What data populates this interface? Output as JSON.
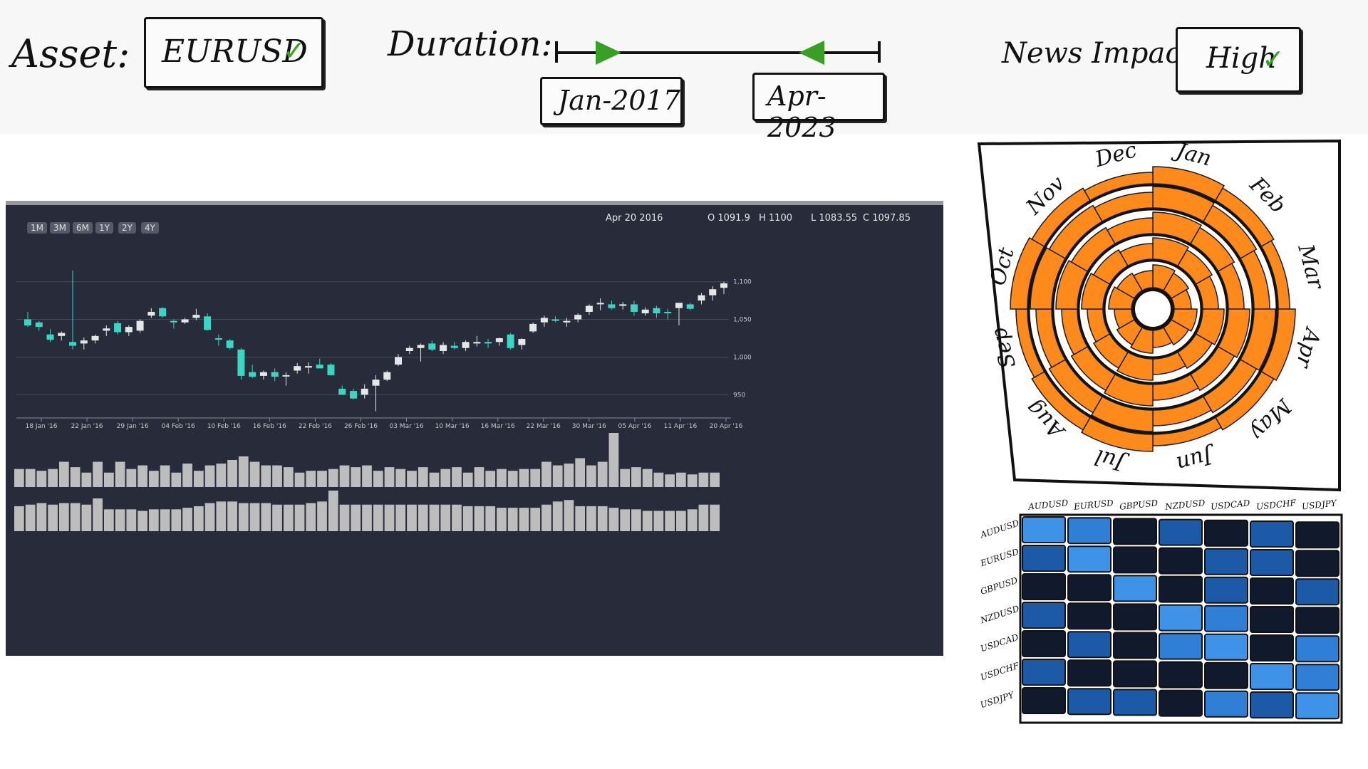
{
  "controls": {
    "asset_label": "Asset:",
    "asset_value": "EURUSD",
    "duration_label": "Duration:",
    "duration_start": "Jan-2017",
    "duration_end": "Apr-2023",
    "news_label": "News Impact",
    "news_value": "High"
  },
  "chart": {
    "range_buttons": [
      "1M",
      "3M",
      "6M",
      "1Y",
      "2Y",
      "4Y"
    ],
    "date": "Apr 20 2016",
    "open": "O 1091.9",
    "high": "H 1100",
    "low": "L 1083.55",
    "close": "C 1097.85",
    "colors": {
      "background": "#272b3a",
      "up": "#e6e6e6",
      "down": "#3ad6c2",
      "volume": "#bdbdbd"
    }
  },
  "chart_data": {
    "type": "candlestick",
    "x_ticks": [
      "18 Jan '16",
      "22 Jan '16",
      "29 Jan '16",
      "04 Feb '16",
      "10 Feb '16",
      "16 Feb '16",
      "22 Feb '16",
      "26 Feb '16",
      "03 Mar '16",
      "10 Mar '16",
      "16 Mar '16",
      "22 Mar '16",
      "30 Mar '16",
      "05 Apr '16",
      "11 Apr '16",
      "20 Apr '16"
    ],
    "y_ticks": [
      "1,100",
      "1,050",
      "1,000",
      "950"
    ],
    "ylim": [
      922,
      1128
    ],
    "candles": [
      [
        1050,
        1060,
        1040,
        1042
      ],
      [
        1046,
        1048,
        1035,
        1040
      ],
      [
        1030,
        1037,
        1020,
        1023
      ],
      [
        1028,
        1034,
        1022,
        1032
      ],
      [
        1020,
        1115,
        1010,
        1015
      ],
      [
        1018,
        1026,
        1010,
        1022
      ],
      [
        1022,
        1030,
        1018,
        1028
      ],
      [
        1035,
        1042,
        1028,
        1038
      ],
      [
        1045,
        1048,
        1030,
        1033
      ],
      [
        1033,
        1042,
        1028,
        1040
      ],
      [
        1035,
        1050,
        1032,
        1048
      ],
      [
        1055,
        1065,
        1052,
        1060
      ],
      [
        1065,
        1066,
        1052,
        1054
      ],
      [
        1048,
        1050,
        1038,
        1046
      ],
      [
        1046,
        1052,
        1044,
        1050
      ],
      [
        1052,
        1064,
        1049,
        1056
      ],
      [
        1054,
        1058,
        1035,
        1036
      ],
      [
        1025,
        1030,
        1015,
        1024
      ],
      [
        1022,
        1024,
        1010,
        1012
      ],
      [
        1010,
        1012,
        970,
        975
      ],
      [
        980,
        990,
        972,
        974
      ],
      [
        975,
        982,
        970,
        980
      ],
      [
        980,
        985,
        968,
        974
      ],
      [
        975,
        980,
        962,
        976
      ],
      [
        982,
        992,
        978,
        988
      ],
      [
        986,
        993,
        978,
        988
      ],
      [
        990,
        998,
        988,
        985
      ],
      [
        990,
        992,
        976,
        976
      ],
      [
        958,
        962,
        950,
        950
      ],
      [
        955,
        958,
        944,
        945
      ],
      [
        950,
        964,
        945,
        958
      ],
      [
        962,
        976,
        928,
        970
      ],
      [
        970,
        982,
        968,
        980
      ],
      [
        990,
        1004,
        988,
        1000
      ],
      [
        1008,
        1015,
        1004,
        1012
      ],
      [
        1012,
        1018,
        994,
        1016
      ],
      [
        1018,
        1022,
        1008,
        1010
      ],
      [
        1008,
        1020,
        1004,
        1016
      ],
      [
        1015,
        1020,
        1010,
        1012
      ],
      [
        1012,
        1022,
        1008,
        1020
      ],
      [
        1018,
        1028,
        1014,
        1020
      ],
      [
        1020,
        1024,
        1012,
        1018
      ],
      [
        1020,
        1026,
        1015,
        1025
      ],
      [
        1030,
        1032,
        1010,
        1012
      ],
      [
        1016,
        1025,
        1010,
        1024
      ],
      [
        1034,
        1046,
        1032,
        1044
      ],
      [
        1046,
        1055,
        1040,
        1052
      ],
      [
        1050,
        1054,
        1046,
        1048
      ],
      [
        1046,
        1052,
        1040,
        1048
      ],
      [
        1050,
        1058,
        1046,
        1056
      ],
      [
        1060,
        1070,
        1056,
        1068
      ],
      [
        1070,
        1078,
        1062,
        1072
      ],
      [
        1070,
        1075,
        1063,
        1065
      ],
      [
        1068,
        1073,
        1063,
        1070
      ],
      [
        1070,
        1075,
        1055,
        1060
      ],
      [
        1058,
        1066,
        1055,
        1063
      ],
      [
        1065,
        1068,
        1052,
        1058
      ],
      [
        1060,
        1064,
        1050,
        1058
      ],
      [
        1065,
        1070,
        1042,
        1072
      ],
      [
        1070,
        1072,
        1062,
        1064
      ],
      [
        1075,
        1085,
        1070,
        1082
      ],
      [
        1082,
        1094,
        1075,
        1090
      ],
      [
        1091.9,
        1100,
        1083.55,
        1097.85
      ]
    ],
    "volume_upper": [
      10,
      10,
      9,
      10,
      14,
      11,
      8,
      14,
      8,
      14,
      10,
      12,
      9,
      12,
      8,
      13,
      9,
      12,
      13,
      15,
      17,
      14,
      12,
      12,
      11,
      8,
      9,
      9,
      10,
      12,
      11,
      12,
      9,
      11,
      10,
      9,
      11,
      8,
      10,
      11,
      8,
      11,
      9,
      10,
      9,
      10,
      10,
      14,
      12,
      13,
      16,
      12,
      14,
      30,
      10,
      11,
      10,
      8,
      7,
      8,
      7,
      8,
      8
    ],
    "volume_lower": [
      16,
      17,
      18,
      17,
      18,
      18,
      17,
      21,
      14,
      14,
      14,
      13,
      14,
      14,
      14,
      15,
      16,
      18,
      19,
      19,
      18,
      18,
      18,
      17,
      17,
      17,
      18,
      19,
      26,
      17,
      17,
      17,
      17,
      17,
      17,
      17,
      17,
      17,
      17,
      17,
      16,
      16,
      16,
      15,
      15,
      15,
      15,
      17,
      19,
      20,
      16,
      16,
      16,
      15,
      14,
      14,
      13,
      13,
      13,
      13,
      14,
      17,
      17
    ]
  },
  "radial": {
    "months": [
      "Jan",
      "Feb",
      "Mar",
      "Apr",
      "May",
      "Jun",
      "Jul",
      "Aug",
      "Sep",
      "Oct",
      "Nov",
      "Dec"
    ],
    "color": "#ff8a1c"
  },
  "heatmap": {
    "pairs": [
      "AUDUSD",
      "EURUSD",
      "GBPUSD",
      "NZDUSD",
      "USDCAD",
      "USDCHF",
      "USDJPY"
    ],
    "levels": [
      [
        3,
        2,
        0,
        1,
        0,
        1,
        0
      ],
      [
        1,
        3,
        0,
        0,
        1,
        1,
        0
      ],
      [
        0,
        0,
        3,
        0,
        1,
        0,
        1
      ],
      [
        1,
        0,
        0,
        3,
        2,
        0,
        0
      ],
      [
        0,
        1,
        0,
        2,
        3,
        0,
        2
      ],
      [
        1,
        0,
        0,
        0,
        0,
        3,
        2
      ],
      [
        0,
        1,
        1,
        0,
        2,
        1,
        3
      ]
    ],
    "colors": [
      "#101a2c",
      "#1c5aa8",
      "#2f7fd6",
      "#3e92e8"
    ]
  }
}
